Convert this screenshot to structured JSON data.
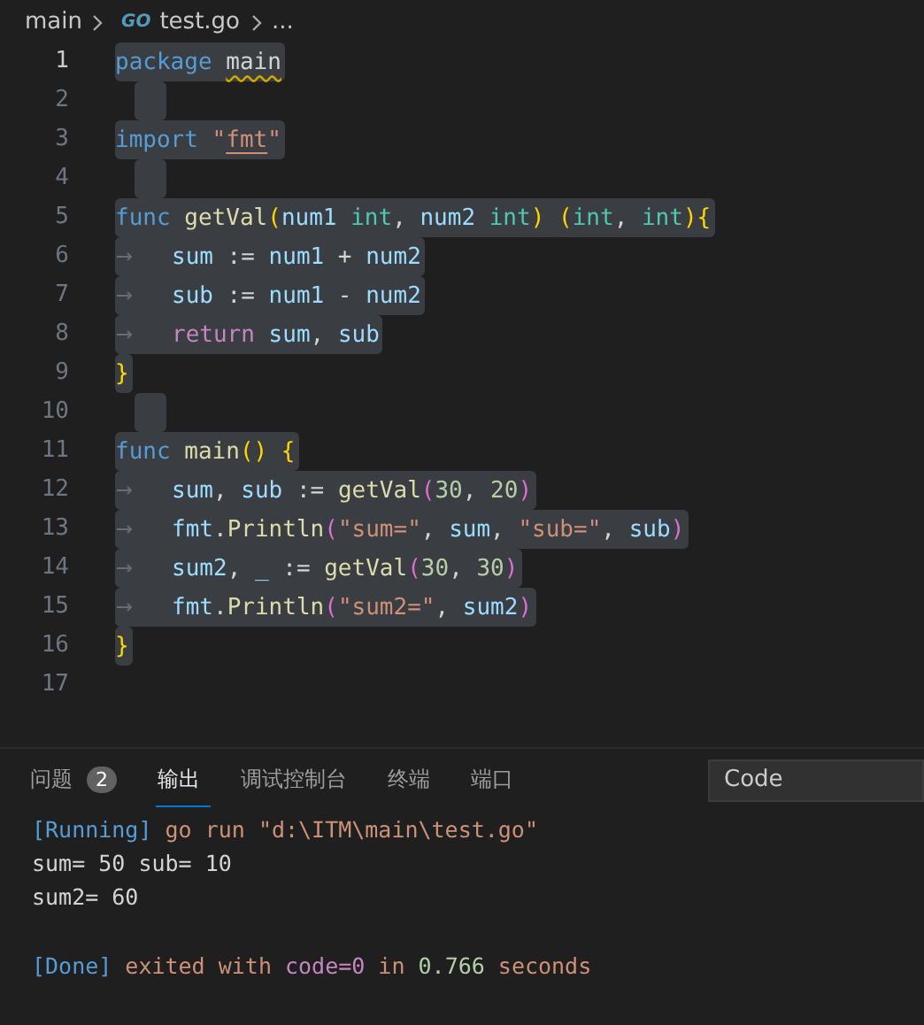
{
  "breadcrumb": {
    "folder": "main",
    "file_icon": "GO",
    "file": "test.go",
    "more": "..."
  },
  "editor": {
    "lines": [
      {
        "number": "1",
        "current": true,
        "selected": true,
        "indented": false,
        "tokens": [
          {
            "text": "package ",
            "kind": "kw"
          },
          {
            "text": "main",
            "kind": "plain",
            "squiggle": true
          }
        ]
      },
      {
        "number": "2",
        "current": false,
        "selected": true,
        "indented": false
      },
      {
        "number": "3",
        "current": false,
        "selected": true,
        "indented": false,
        "tokens": [
          {
            "text": "import ",
            "kind": "kw"
          },
          {
            "text": "\"",
            "kind": "str"
          },
          {
            "text": "fmt",
            "kind": "str",
            "underline": true
          },
          {
            "text": "\"",
            "kind": "str"
          }
        ]
      },
      {
        "number": "4",
        "current": false,
        "selected": true,
        "indented": false
      },
      {
        "number": "5",
        "current": false,
        "selected": true,
        "indented": false,
        "tokens": [
          {
            "text": "func ",
            "kind": "kw"
          },
          {
            "text": "getVal",
            "kind": "fn"
          },
          {
            "text": "(",
            "kind": "brace"
          },
          {
            "text": "num1 ",
            "kind": "var"
          },
          {
            "text": "int",
            "kind": "type"
          },
          {
            "text": ", ",
            "kind": "plain"
          },
          {
            "text": "num2 ",
            "kind": "var"
          },
          {
            "text": "int",
            "kind": "type"
          },
          {
            "text": ") (",
            "kind": "brace"
          },
          {
            "text": "int",
            "kind": "type"
          },
          {
            "text": ", ",
            "kind": "plain"
          },
          {
            "text": "int",
            "kind": "type"
          },
          {
            "text": "){",
            "kind": "brace"
          }
        ]
      },
      {
        "number": "6",
        "current": false,
        "selected": true,
        "indented": true,
        "tokens": [
          {
            "text": "sum",
            "kind": "var"
          },
          {
            "text": " := ",
            "kind": "plain"
          },
          {
            "text": "num1",
            "kind": "var"
          },
          {
            "text": " + ",
            "kind": "plain"
          },
          {
            "text": "num2",
            "kind": "var"
          }
        ]
      },
      {
        "number": "7",
        "current": false,
        "selected": true,
        "indented": true,
        "tokens": [
          {
            "text": "sub",
            "kind": "var"
          },
          {
            "text": " := ",
            "kind": "plain"
          },
          {
            "text": "num1",
            "kind": "var"
          },
          {
            "text": " - ",
            "kind": "plain"
          },
          {
            "text": "num2",
            "kind": "var"
          }
        ]
      },
      {
        "number": "8",
        "current": false,
        "selected": true,
        "indented": true,
        "tokens": [
          {
            "text": "return ",
            "kind": "ctrl"
          },
          {
            "text": "sum",
            "kind": "var"
          },
          {
            "text": ", ",
            "kind": "plain"
          },
          {
            "text": "sub",
            "kind": "var"
          }
        ]
      },
      {
        "number": "9",
        "current": false,
        "selected": true,
        "indented": false,
        "tokens": [
          {
            "text": "}",
            "kind": "brace"
          }
        ]
      },
      {
        "number": "10",
        "current": false,
        "selected": true,
        "indented": false
      },
      {
        "number": "11",
        "current": false,
        "selected": true,
        "indented": false,
        "tokens": [
          {
            "text": "func ",
            "kind": "kw"
          },
          {
            "text": "main",
            "kind": "fn"
          },
          {
            "text": "() {",
            "kind": "brace"
          }
        ]
      },
      {
        "number": "12",
        "current": false,
        "selected": true,
        "indented": true,
        "tokens": [
          {
            "text": "sum",
            "kind": "var"
          },
          {
            "text": ", ",
            "kind": "plain"
          },
          {
            "text": "sub",
            "kind": "var"
          },
          {
            "text": " := ",
            "kind": "plain"
          },
          {
            "text": "getVal",
            "kind": "fn"
          },
          {
            "text": "(",
            "kind": "brace2"
          },
          {
            "text": "30",
            "kind": "num"
          },
          {
            "text": ", ",
            "kind": "plain"
          },
          {
            "text": "20",
            "kind": "num"
          },
          {
            "text": ")",
            "kind": "brace2"
          }
        ]
      },
      {
        "number": "13",
        "current": false,
        "selected": true,
        "indented": true,
        "tokens": [
          {
            "text": "fmt",
            "kind": "var"
          },
          {
            "text": ".",
            "kind": "plain"
          },
          {
            "text": "Println",
            "kind": "fn"
          },
          {
            "text": "(",
            "kind": "brace2"
          },
          {
            "text": "\"sum=\"",
            "kind": "str"
          },
          {
            "text": ", ",
            "kind": "plain"
          },
          {
            "text": "sum",
            "kind": "var"
          },
          {
            "text": ", ",
            "kind": "plain"
          },
          {
            "text": "\"sub=\"",
            "kind": "str"
          },
          {
            "text": ", ",
            "kind": "plain"
          },
          {
            "text": "sub",
            "kind": "var"
          },
          {
            "text": ")",
            "kind": "brace2"
          }
        ]
      },
      {
        "number": "14",
        "current": false,
        "selected": true,
        "indented": true,
        "tokens": [
          {
            "text": "sum2",
            "kind": "var"
          },
          {
            "text": ", ",
            "kind": "plain"
          },
          {
            "text": "_",
            "kind": "var"
          },
          {
            "text": " := ",
            "kind": "plain"
          },
          {
            "text": "getVal",
            "kind": "fn"
          },
          {
            "text": "(",
            "kind": "brace2"
          },
          {
            "text": "30",
            "kind": "num"
          },
          {
            "text": ", ",
            "kind": "plain"
          },
          {
            "text": "30",
            "kind": "num"
          },
          {
            "text": ")",
            "kind": "brace2"
          }
        ]
      },
      {
        "number": "15",
        "current": false,
        "selected": true,
        "indented": true,
        "tokens": [
          {
            "text": "fmt",
            "kind": "var"
          },
          {
            "text": ".",
            "kind": "plain"
          },
          {
            "text": "Println",
            "kind": "fn"
          },
          {
            "text": "(",
            "kind": "brace2"
          },
          {
            "text": "\"sum2=\"",
            "kind": "str"
          },
          {
            "text": ", ",
            "kind": "plain"
          },
          {
            "text": "sum2",
            "kind": "var"
          },
          {
            "text": ")",
            "kind": "brace2"
          }
        ]
      },
      {
        "number": "16",
        "current": false,
        "selected": true,
        "indented": false,
        "tokens": [
          {
            "text": "}",
            "kind": "brace"
          }
        ]
      },
      {
        "number": "17",
        "current": false,
        "selected": false,
        "indented": false
      }
    ]
  },
  "panel": {
    "tabs": [
      {
        "label": "问题",
        "badge": "2",
        "selected": false
      },
      {
        "label": "输出",
        "selected": true
      },
      {
        "label": "调试控制台",
        "selected": false
      },
      {
        "label": "终端",
        "selected": false
      },
      {
        "label": "端口",
        "selected": false
      }
    ],
    "channel_select": {
      "value": "Code"
    },
    "output": [
      {
        "gap_before": false,
        "tokens": [
          {
            "text": "[Running]",
            "kind": "kw"
          },
          {
            "text": " go run \"d:\\ITM\\main\\test.go\"",
            "kind": "str"
          }
        ]
      },
      {
        "gap_before": false,
        "tokens": [
          {
            "text": "sum= 50 sub= 10",
            "kind": "plain"
          }
        ]
      },
      {
        "gap_before": false,
        "tokens": [
          {
            "text": "sum2= 60",
            "kind": "plain"
          }
        ]
      },
      {
        "gap_before": true,
        "tokens": [
          {
            "text": "[Done]",
            "kind": "kw"
          },
          {
            "text": " exited with ",
            "kind": "str"
          },
          {
            "text": "code=0",
            "kind": "ctrl"
          },
          {
            "text": " in ",
            "kind": "str"
          },
          {
            "text": "0.766",
            "kind": "num"
          },
          {
            "text": " seconds",
            "kind": "str"
          }
        ]
      }
    ]
  }
}
